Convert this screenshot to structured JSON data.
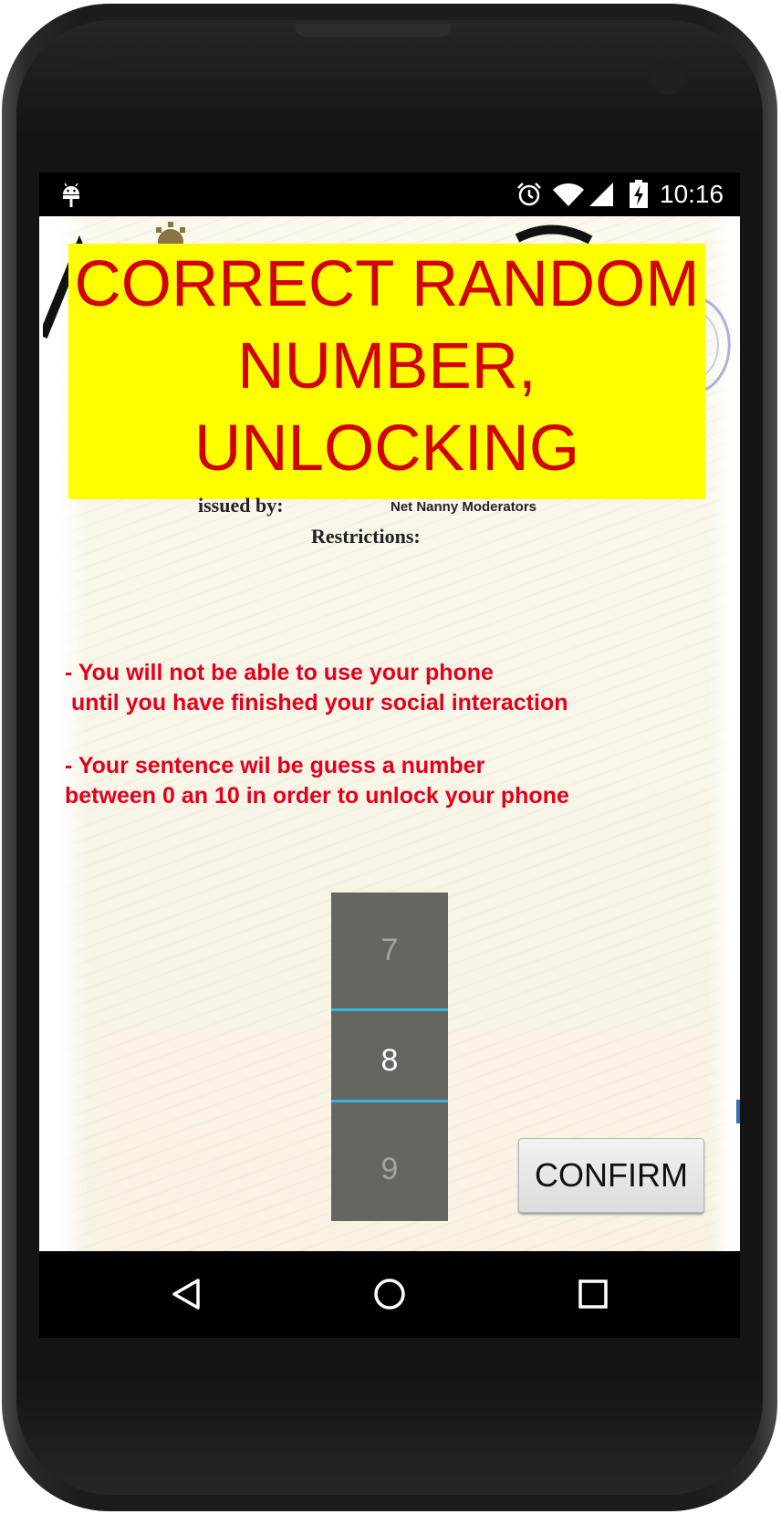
{
  "status_bar": {
    "time": "10:16",
    "icons": [
      "android-debug-icon",
      "alarm-icon",
      "wifi-icon",
      "cell-signal-icon",
      "battery-charging-icon"
    ]
  },
  "banner": {
    "lines": [
      "CORRECT RANDOM",
      "NUMBER,",
      "UNLOCKING"
    ],
    "background_color": "#ffff00",
    "text_color": "#d20000"
  },
  "certificate": {
    "issued_label": "issued by:",
    "issued_value": "Net Nanny Moderators",
    "restrictions_label": "Restrictions:",
    "rule1_lines": [
      "- You will not be able to use your phone",
      " until you have finished your social interaction"
    ],
    "rule2_lines": [
      "- Your sentence wil be guess a number",
      "between 0 an 10 in order to unlock your phone"
    ],
    "rule_color": "#e4001a"
  },
  "picker": {
    "prev": "7",
    "current": "8",
    "next": "9",
    "divider_color": "#33b5e5"
  },
  "confirm_button": {
    "label": "CONFIRM"
  },
  "nav_bar": {
    "icons": [
      "back-icon",
      "home-icon",
      "recents-icon"
    ]
  }
}
